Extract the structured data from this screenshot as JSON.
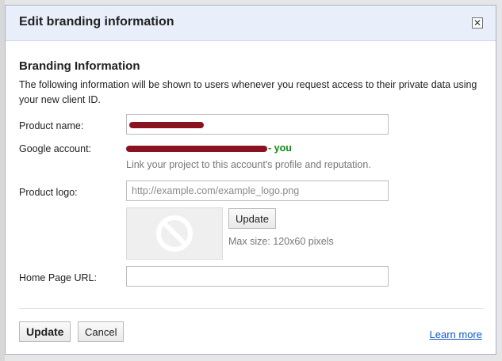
{
  "dialog": {
    "title": "Edit branding information",
    "close_glyph": "✕"
  },
  "branding": {
    "section_title": "Branding Information",
    "description": "The following information will be shown to users whenever you request access to their private data using your new client ID."
  },
  "product_name": {
    "label": "Product name:",
    "value": ""
  },
  "google_account": {
    "label": "Google account:",
    "you_text": "- you",
    "hint": "Link your project to this account's profile and reputation."
  },
  "product_logo": {
    "label": "Product logo:",
    "placeholder": "http://example.com/example_logo.png",
    "update_label": "Update",
    "max_size": "Max size: 120x60 pixels"
  },
  "home_page": {
    "label": "Home Page URL:",
    "value": ""
  },
  "footer": {
    "update_label": "Update",
    "cancel_label": "Cancel",
    "learn_more": "Learn more"
  },
  "colors": {
    "you_green": "#138a13",
    "link_blue": "#1155cc",
    "redaction": "#8b1320"
  }
}
